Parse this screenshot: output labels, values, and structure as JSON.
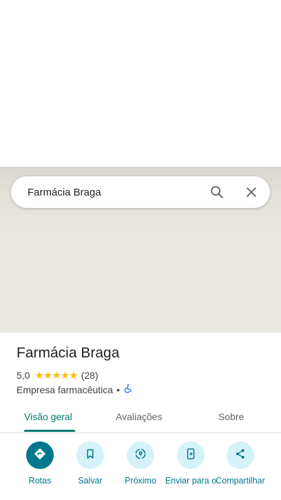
{
  "search": {
    "query": "Farmácia Braga"
  },
  "place": {
    "name": "Farmácia Braga",
    "rating": "5,0",
    "stars": "★★★★★",
    "review_count": "(28)",
    "category": "Empresa farmacêutica",
    "separator": "•"
  },
  "tabs": [
    {
      "label": "Visão geral",
      "active": true
    },
    {
      "label": "Avaliações",
      "active": false
    },
    {
      "label": "Sobre",
      "active": false
    }
  ],
  "actions": [
    {
      "label": "Rotas",
      "icon": "directions-icon"
    },
    {
      "label": "Salvar",
      "icon": "bookmark-icon"
    },
    {
      "label": "Próximo",
      "icon": "nearby-icon"
    },
    {
      "label": "Enviar para o",
      "icon": "send-to-phone-icon"
    },
    {
      "label": "Compartilhar",
      "icon": "share-icon"
    }
  ],
  "colors": {
    "accent": "#00796b",
    "action_primary": "#00778c",
    "action_bg": "#d5f2f8",
    "star": "#fbbc04"
  }
}
